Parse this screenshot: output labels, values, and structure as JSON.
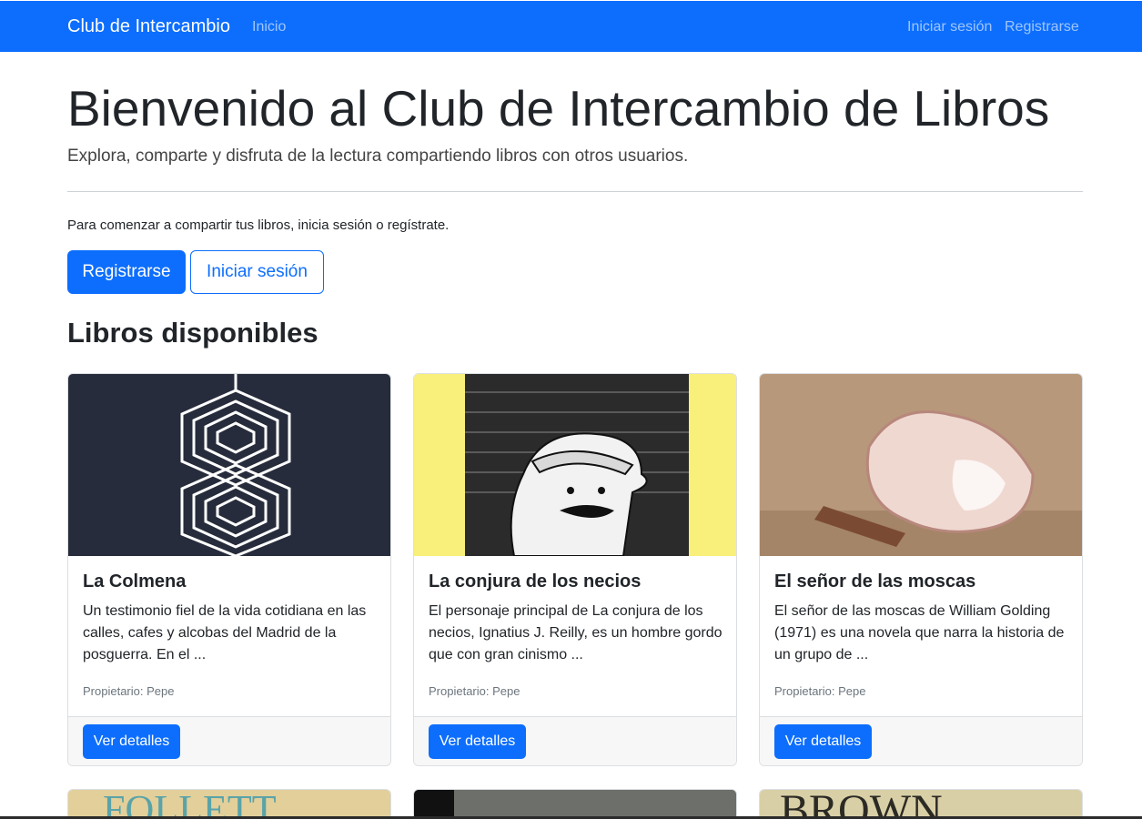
{
  "navbar": {
    "brand": "Club de Intercambio",
    "home": "Inicio",
    "login": "Iniciar sesión",
    "register": "Registrarse",
    "bg_color": "#0d6efd"
  },
  "hero": {
    "title": "Bienvenido al Club de Intercambio de Libros",
    "lead": "Explora, comparte y disfruta de la lectura compartiendo libros con otros usuarios.",
    "intro": "Para comenzar a compartir tus libros, inicia sesión o regístrate.",
    "register_button": "Registrarse",
    "login_button": "Iniciar sesión"
  },
  "books_section": {
    "title": "Libros disponibles",
    "books": [
      {
        "title": "La Colmena",
        "description": "Un testimonio fiel de la vida cotidiana en las calles, cafes y alcobas del Madrid de la posguerra. En el ...",
        "owner": "Propietario: Pepe",
        "button": "Ver detalles"
      },
      {
        "title": "La conjura de los necios",
        "description": "El personaje principal de La conjura de los necios, Ignatius J. Reilly, es un hombre gordo que con gran cinismo ...",
        "owner": "Propietario: Pepe",
        "button": "Ver detalles"
      },
      {
        "title": "El señor de las moscas",
        "description": "El señor de las moscas de William Golding (1971) es una novela que narra la historia de un grupo de ...",
        "owner": "Propietario: Pepe",
        "button": "Ver detalles"
      }
    ],
    "next_row_cover_text": [
      "FOLLETT",
      "",
      "BROWN"
    ]
  },
  "colors": {
    "primary": "#0d6efd",
    "card_footer": "#f7f7f7",
    "muted": "#6c757d"
  }
}
